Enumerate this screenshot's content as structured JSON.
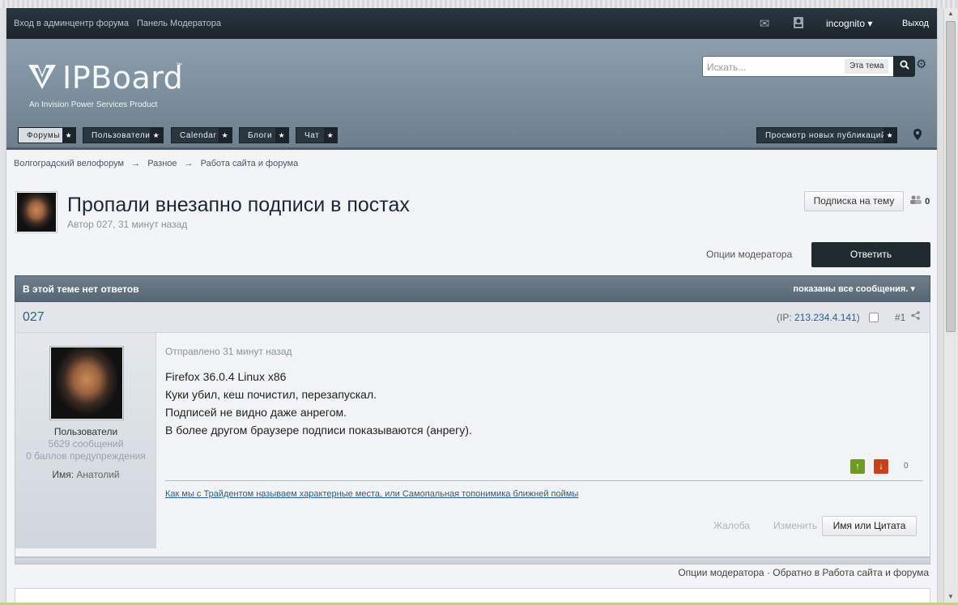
{
  "userbar": {
    "admincp": "Вход в админцентр форума",
    "modpanel": "Панель Модератора",
    "username": "incognito",
    "logout": "Выход",
    "icons": [
      "envelope-icon",
      "contact-card-icon"
    ]
  },
  "branding": {
    "logo_word": "IPBoard",
    "logo_tm": "™",
    "logo_tagline": "An Invision Power Services Product"
  },
  "search": {
    "placeholder": "Искать...",
    "scope": "Эта тема"
  },
  "nav": {
    "tabs": [
      "Форумы",
      "Пользователи",
      "Calendar",
      "Блоги",
      "Чат"
    ],
    "new_content": "Просмотр новых публикаций"
  },
  "breadcrumb": [
    "Волгоградский велофорум",
    "Разное",
    "Работа сайта и форума"
  ],
  "breadcrumb_sep": "→",
  "topic": {
    "title": "Пропали внезапно подписи в постах",
    "byline": "Автор 027, 31 минут назад",
    "follow": "Подписка на тему",
    "followers": "0",
    "mod_options": "Опции модератора",
    "reply": "Ответить",
    "bar_left": "В этой теме нет ответов",
    "bar_right": "показаны все сообщения."
  },
  "post": {
    "author": "027",
    "ip_prefix": "(IP: ",
    "ip": "213.234.4.141",
    "ip_suffix": ")",
    "number": "#1",
    "group": "Пользователи",
    "posts_count": "5629 сообщений",
    "warn_points": "0 баллов предупреждения",
    "name_label": "Имя:",
    "name_value": "Анатолий",
    "posted": "Отправлено 31 минут назад",
    "lines": [
      "Firefox 36.0.4 Linux x86",
      "Куки убил, кеш почистил, перезапускал.",
      "Подписей не видно даже анрегом.",
      "В более другом браузере подписи показываются (анрегу)."
    ],
    "reputation": "0",
    "signature": "Как мы с Трайдентом называем характерные места, или Самопальная топонимика ближней поймы",
    "report": "Жалоба",
    "edit": "Изменить",
    "quote": "Имя или Цитата"
  },
  "footer": {
    "mod_options": "Опции модератора",
    "dot": "·",
    "back": "Обратно в Работа сайта и форума"
  }
}
